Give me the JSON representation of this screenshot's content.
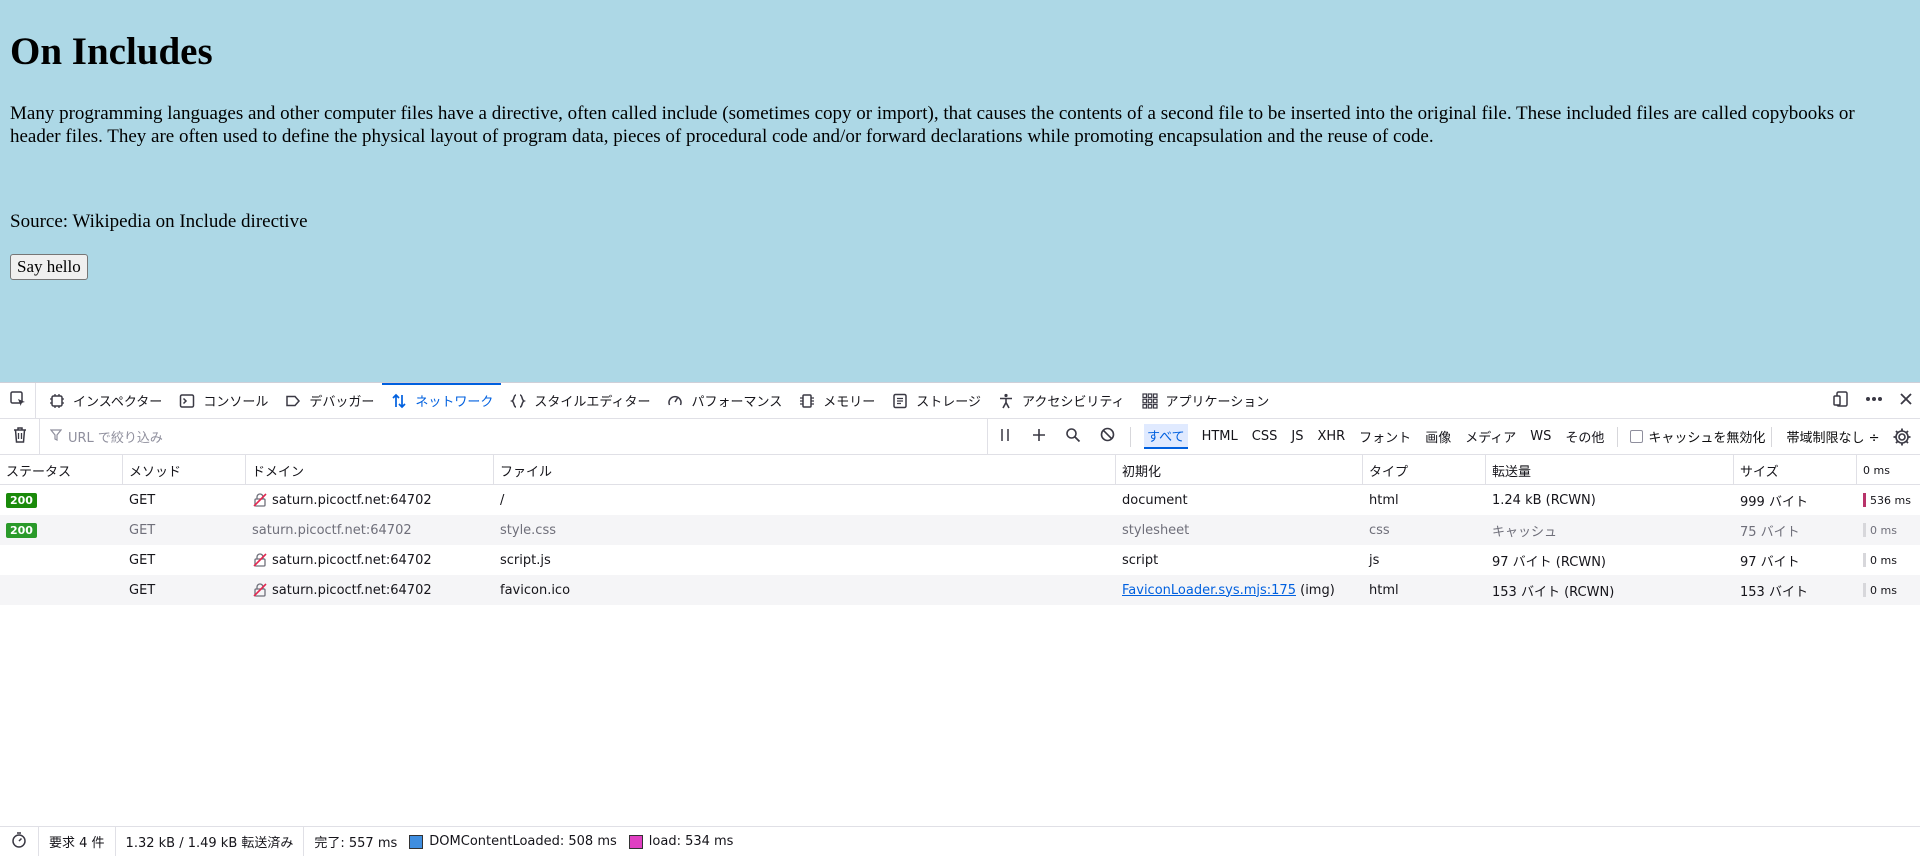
{
  "page": {
    "heading": "On Includes",
    "paragraph": "Many programming languages and other computer files have a directive, often called include (sometimes copy or import), that causes the contents of a second file to be inserted into the original file. These included files are called copybooks or header files. They are often used to define the physical layout of program data, pieces of procedural code and/or forward declarations while promoting encapsulation and the reuse of code.",
    "source": "Source: Wikipedia on Include directive",
    "button_label": "Say hello",
    "background_color": "#add8e6"
  },
  "devtools": {
    "tabs": [
      {
        "label": "インスペクター",
        "icon": "inspector-icon"
      },
      {
        "label": "コンソール",
        "icon": "console-icon"
      },
      {
        "label": "デバッガー",
        "icon": "debugger-icon"
      },
      {
        "label": "ネットワーク",
        "icon": "network-icon",
        "active": true
      },
      {
        "label": "スタイルエディター",
        "icon": "style-editor-icon"
      },
      {
        "label": "パフォーマンス",
        "icon": "performance-icon"
      },
      {
        "label": "メモリー",
        "icon": "memory-icon"
      },
      {
        "label": "ストレージ",
        "icon": "storage-icon"
      },
      {
        "label": "アクセシビリティ",
        "icon": "accessibility-icon"
      },
      {
        "label": "アプリケーション",
        "icon": "application-icon"
      }
    ],
    "filter_placeholder": "URL で絞り込み",
    "type_filters": [
      "すべて",
      "HTML",
      "CSS",
      "JS",
      "XHR",
      "フォント",
      "画像",
      "メディア",
      "WS",
      "その他"
    ],
    "disable_cache_label": "キャッシュを無効化",
    "throttle_label": "帯域制限なし ÷",
    "columns": [
      "ステータス",
      "メソッド",
      "ドメイン",
      "ファイル",
      "初期化",
      "タイプ",
      "転送量",
      "サイズ",
      "0 ms"
    ],
    "rows": [
      {
        "status": "200",
        "method": "GET",
        "domain": "saturn.picoctf.net:64702",
        "file": "/",
        "initiator": "document",
        "initiator_link": "",
        "initiator_suffix": "",
        "type": "html",
        "transferred": "1.24 kB (RCWN)",
        "size": "999 バイト",
        "time": "536 ms",
        "insecure": true,
        "dim": false
      },
      {
        "status": "200",
        "method": "GET",
        "domain": "saturn.picoctf.net:64702",
        "file": "style.css",
        "initiator": "stylesheet",
        "initiator_link": "",
        "initiator_suffix": "",
        "type": "css",
        "transferred": "キャッシュ",
        "size": "75 バイト",
        "time": "0 ms",
        "insecure": false,
        "dim": true
      },
      {
        "status": "",
        "method": "GET",
        "domain": "saturn.picoctf.net:64702",
        "file": "script.js",
        "initiator": "script",
        "initiator_link": "",
        "initiator_suffix": "",
        "type": "js",
        "transferred": "97 バイト (RCWN)",
        "size": "97 バイト",
        "time": "0 ms",
        "insecure": true,
        "dim": false
      },
      {
        "status": "",
        "method": "GET",
        "domain": "saturn.picoctf.net:64702",
        "file": "favicon.ico",
        "initiator": "",
        "initiator_link": "FaviconLoader.sys.mjs:175",
        "initiator_suffix": " (img)",
        "type": "html",
        "transferred": "153 バイト (RCWN)",
        "size": "153 バイト",
        "time": "0 ms",
        "insecure": true,
        "dim": false
      }
    ],
    "statusbar": {
      "requests": "要求 4 件",
      "transfer": "1.32 kB / 1.49 kB 転送済み",
      "finish": "完了: 557 ms",
      "dom_content_loaded": "DOMContentLoaded: 508 ms",
      "load": "load: 534 ms",
      "dcl_color": "#3f8ee0",
      "load_color": "#e03fc2"
    },
    "accent_color": "#0060df"
  }
}
